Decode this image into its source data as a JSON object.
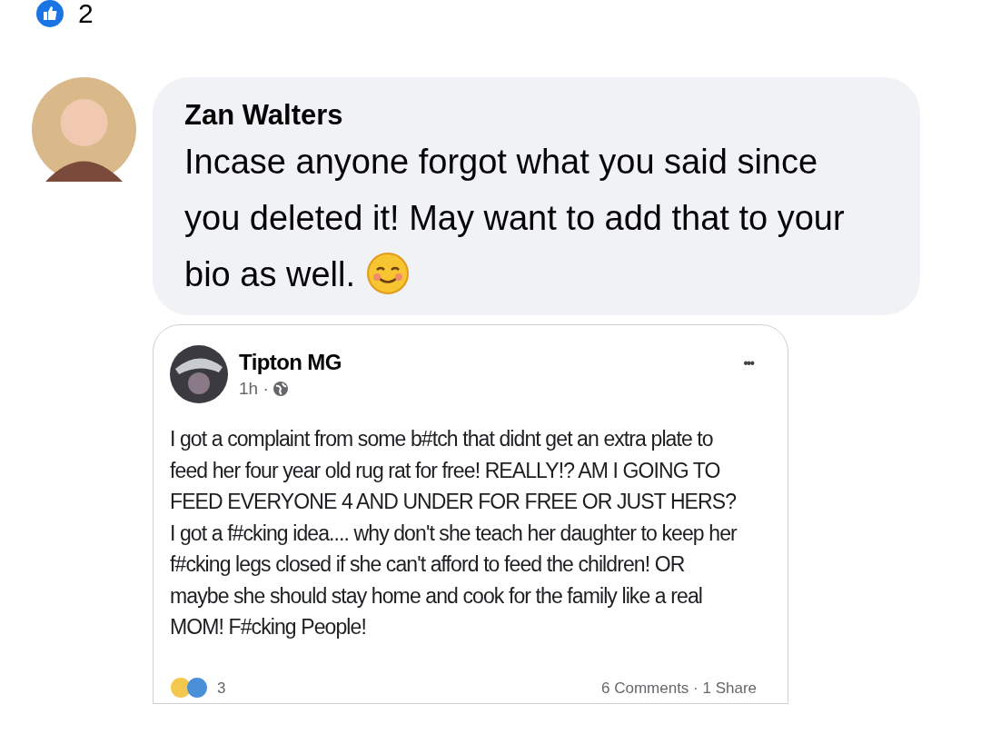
{
  "reactions": {
    "count": "2"
  },
  "comment": {
    "author": "Zan Walters",
    "text": "Incase anyone forgot what you said since you deleted it! May want to add that to your bio as well."
  },
  "shared_post": {
    "author": "Tipton MG",
    "time": "1h ·",
    "menu": "•••",
    "text": "I got a complaint from some b#tch that didnt get an extra plate to feed her four year old rug rat for free! REALLY!? AM I GOING TO FEED EVERYONE 4 AND UNDER FOR FREE OR JUST HERS? I got a f#cking idea.... why don't she teach her daughter to keep her f#cking legs closed if she can't afford to feed the children! OR maybe she should stay home and cook for the family like a real MOM! F#cking People!",
    "reaction_count": "3",
    "stats": "6 Comments · 1 Share"
  }
}
